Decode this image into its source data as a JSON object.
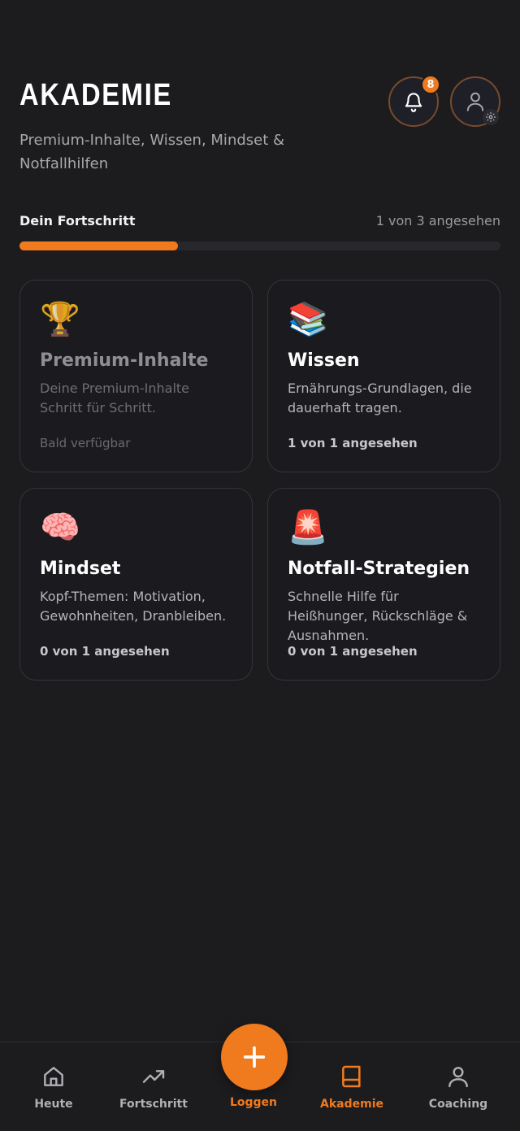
{
  "header": {
    "title": "AKADEMIE",
    "subtitle": "Premium-Inhalte, Wissen, Mindset & Notfallhilfen",
    "notification_count": "8"
  },
  "progress": {
    "label": "Dein Fortschritt",
    "count_text": "1 von 3 angesehen",
    "fraction": 0.33
  },
  "cards": [
    {
      "icon": "trophy-icon",
      "emoji": "🏆",
      "title": "Premium-Inhalte",
      "description": "Deine Premium-Inhalte Schritt für Schritt.",
      "meta": "Bald verfügbar"
    },
    {
      "icon": "books-icon",
      "emoji": "📚",
      "title": "Wissen",
      "description": "Ernährungs-Grundlagen, die dauerhaft tragen.",
      "meta": "1 von 1 angesehen"
    },
    {
      "icon": "brain-icon",
      "emoji": "🧠",
      "title": "Mindset",
      "description": "Kopf-Themen: Motivation, Gewohnheiten, Dranbleiben.",
      "meta": "0 von 1 angesehen"
    },
    {
      "icon": "siren-icon",
      "emoji": "🚨",
      "title": "Notfall-Strategien",
      "description": "Schnelle Hilfe für Heißhunger, Rückschläge & Ausnahmen.",
      "meta": "0 von 1 angesehen"
    }
  ],
  "nav": {
    "items": [
      {
        "label": "Heute",
        "icon": "home-icon"
      },
      {
        "label": "Fortschritt",
        "icon": "trending-up-icon"
      },
      {
        "label": "Loggen",
        "icon": "plus-icon"
      },
      {
        "label": "Akademie",
        "icon": "book-icon"
      },
      {
        "label": "Coaching",
        "icon": "person-icon"
      }
    ],
    "active": "Akademie"
  },
  "colors": {
    "accent": "#f07a1e",
    "background": "#1c1c1e",
    "card_border": "#34343a"
  }
}
